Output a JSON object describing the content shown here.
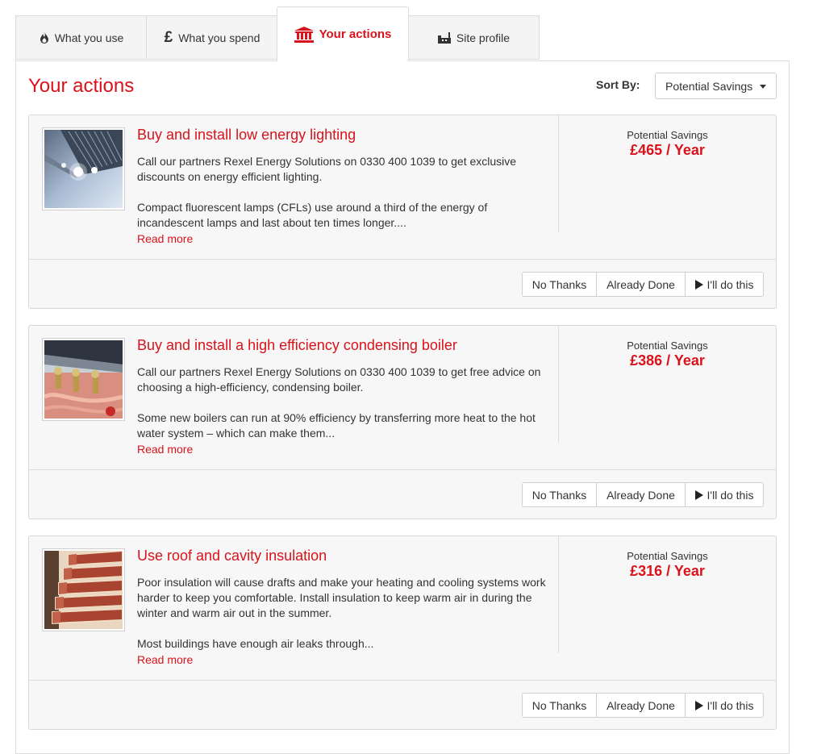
{
  "tabs": [
    {
      "label": "What you use",
      "icon": "flame-icon"
    },
    {
      "label": "What you spend",
      "icon": "pound-icon"
    },
    {
      "label": "Your actions",
      "icon": "bank-building-icon"
    },
    {
      "label": "Site profile",
      "icon": "factory-icon"
    }
  ],
  "active_tab": "Your actions",
  "colors": {
    "accent": "#d8131b",
    "card_background": "#f7f7f7",
    "border": "#dcdcdc"
  },
  "main": {
    "title": "Your actions",
    "sort": {
      "label": "Sort By:",
      "selected": "Potential Savings"
    }
  },
  "actions": [
    {
      "title": "Buy and install low energy lighting",
      "image": "lighting-photo",
      "paragraphs": [
        "Call our partners Rexel Energy Solutions on 0330 400 1039 to get exclusive discounts on energy efficient lighting.",
        "Compact fluorescent lamps (CFLs) use around a third of the energy of incandescent lamps and last about ten times longer...."
      ],
      "read_more": "Read more",
      "savings_label": "Potential Savings",
      "savings_value": "£465 / Year",
      "buttons": {
        "no_thanks": "No Thanks",
        "already_done": "Already Done",
        "will_do": "I'll do this"
      }
    },
    {
      "title": "Buy and install a high efficiency condensing boiler",
      "image": "boiler-photo",
      "paragraphs": [
        "Call our partners Rexel Energy Solutions on 0330 400 1039 to get free advice on choosing a high-efficiency, condensing boiler.",
        "Some new boilers can run at 90% efficiency by transferring more heat to the hot water system – which can make them..."
      ],
      "read_more": "Read more",
      "savings_label": "Potential Savings",
      "savings_value": "£386 / Year",
      "buttons": {
        "no_thanks": "No Thanks",
        "already_done": "Already Done",
        "will_do": "I'll do this"
      }
    },
    {
      "title": "Use roof and cavity insulation",
      "image": "brick-wall-photo",
      "paragraphs": [
        "Poor insulation will cause drafts and make your heating and cooling systems work harder to keep you comfortable. Install insulation to keep warm air in during the winter and warm air out in the summer.",
        "Most buildings have enough air leaks through..."
      ],
      "read_more": "Read more",
      "savings_label": "Potential Savings",
      "savings_value": "£316 / Year",
      "buttons": {
        "no_thanks": "No Thanks",
        "already_done": "Already Done",
        "will_do": "I'll do this"
      }
    }
  ]
}
